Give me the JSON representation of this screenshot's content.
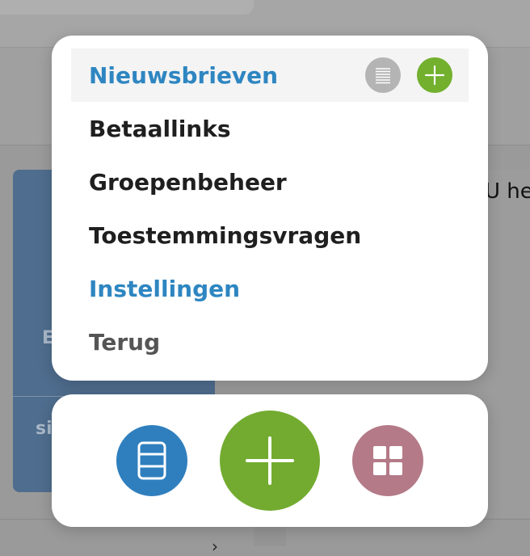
{
  "background": {
    "card_text_1": "E",
    "card_text_2": "si",
    "right_text": "U he",
    "chevron": "›"
  },
  "menu": {
    "items": [
      {
        "label": "Nieuwsbrieven",
        "state": "active",
        "color": "#2e86c1"
      },
      {
        "label": "Betaallinks"
      },
      {
        "label": "Groepenbeheer"
      },
      {
        "label": "Toestemmingsvragen"
      },
      {
        "label": "Instellingen",
        "color": "#2e86c1"
      },
      {
        "label": "Terug",
        "color": "#555555"
      }
    ],
    "active_item_icons": [
      "list-icon",
      "plus-icon"
    ]
  },
  "actionbar": {
    "buttons": [
      {
        "icon": "document-list-icon",
        "color": "#2f7fbe"
      },
      {
        "icon": "plus-icon",
        "color": "#72ab2f"
      },
      {
        "icon": "grid-icon",
        "color": "#b47a88"
      }
    ]
  },
  "colors": {
    "accent_blue": "#2e86c1",
    "accent_green": "#72b02e",
    "accent_pink": "#b47a88"
  }
}
